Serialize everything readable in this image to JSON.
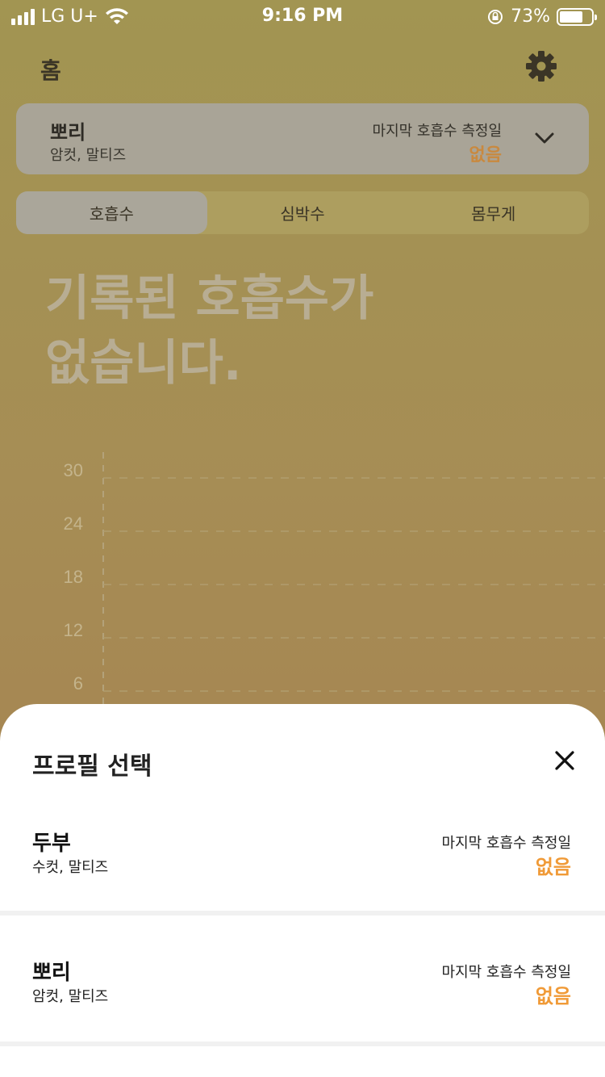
{
  "status_bar": {
    "carrier": "LG U+",
    "time": "9:16 PM",
    "battery": "73%"
  },
  "header": {
    "title": "홈",
    "settings_icon": "gear-icon"
  },
  "current_profile": {
    "name": "뽀리",
    "details": "암컷, 말티즈",
    "measure_label": "마지막 호흡수 측정일",
    "measure_value": "없음"
  },
  "tabs": [
    {
      "label": "호흡수",
      "active": true
    },
    {
      "label": "심박수",
      "active": false
    },
    {
      "label": "몸무게",
      "active": false
    }
  ],
  "empty_message": "기록된 호흡수가 없습니다.",
  "chart_data": {
    "type": "line",
    "y_ticks": [
      "30",
      "24",
      "18",
      "12",
      "6"
    ],
    "ylim": [
      0,
      30
    ],
    "grid": true,
    "series": []
  },
  "sheet": {
    "title": "프로필 선택",
    "close_icon": "close-icon",
    "profiles": [
      {
        "name": "두부",
        "details": "수컷, 말티즈",
        "measure_label": "마지막 호흡수 측정일",
        "measure_value": "없음"
      },
      {
        "name": "뽀리",
        "details": "암컷, 말티즈",
        "measure_label": "마지막 호흡수 측정일",
        "measure_value": "없음"
      }
    ]
  },
  "colors": {
    "accent": "#f09a37",
    "overlay_tint": "#a29552"
  }
}
